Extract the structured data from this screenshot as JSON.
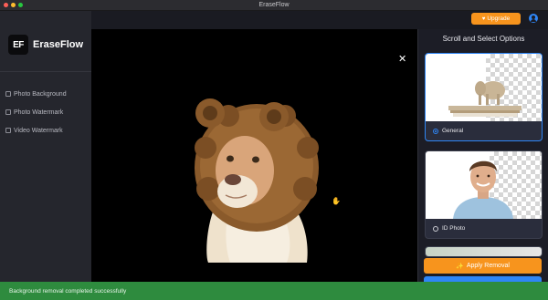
{
  "window": {
    "title": "EraseFlow"
  },
  "brand": {
    "logo_mark": "EF",
    "name": "EraseFlow"
  },
  "sidebar": {
    "items": [
      {
        "label": "Photo Background",
        "icon": "photo-background-icon"
      },
      {
        "label": "Photo Watermark",
        "icon": "photo-watermark-icon"
      },
      {
        "label": "Video Watermark",
        "icon": "video-watermark-icon"
      }
    ]
  },
  "header": {
    "upgrade_label": "Upgrade",
    "upgrade_icon": "heart-icon",
    "account_icon": "user-icon"
  },
  "canvas": {
    "close_glyph": "✕",
    "cursor_glyph": "✋"
  },
  "options_panel": {
    "title": "Scroll and Select Options",
    "options": [
      {
        "label": "General",
        "selected": true
      },
      {
        "label": "ID Photo",
        "selected": false
      }
    ],
    "apply_label": "Apply Removal",
    "apply_icon": "magic-wand-icon"
  },
  "toast": {
    "message": "Background removal completed successfully"
  },
  "colors": {
    "accent": "#f7941d",
    "primary": "#2f86f6",
    "success": "#2e8b3e"
  }
}
